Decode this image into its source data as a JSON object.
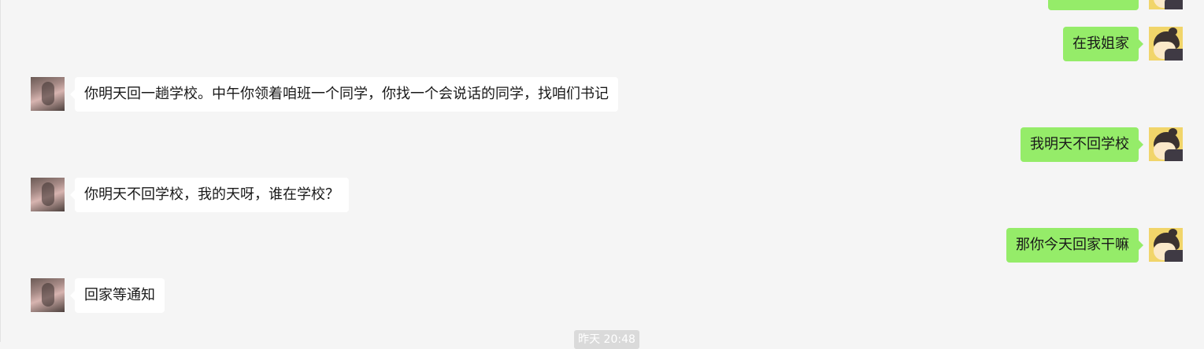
{
  "chat": {
    "messages": [
      {
        "sender": "self",
        "text": "",
        "partial": true
      },
      {
        "sender": "self",
        "text": "在我姐家"
      },
      {
        "sender": "other",
        "text": "你明天回一趟学校。中午你领着咱班一个同学，你找一个会说话的同学，找咱们书记"
      },
      {
        "sender": "self",
        "text": "我明天不回学校"
      },
      {
        "sender": "other",
        "text": "你明天不回学校，我的天呀，谁在学校？"
      },
      {
        "sender": "self",
        "text": "那你今天回家干嘛"
      },
      {
        "sender": "other",
        "text": "回家等通知"
      }
    ],
    "timestamp": "昨天 20:48"
  },
  "colors": {
    "background": "#f5f5f5",
    "self_bubble": "#95ec69",
    "other_bubble": "#ffffff",
    "text": "#191919"
  }
}
